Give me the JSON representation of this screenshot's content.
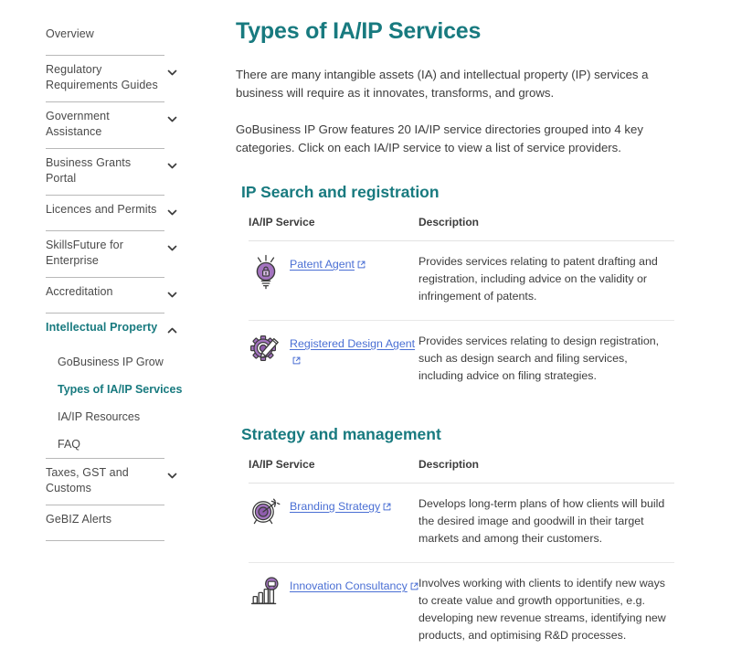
{
  "sidebar": {
    "items": [
      {
        "label": "Overview",
        "expandable": false,
        "active": false
      },
      {
        "label": "Regulatory Requirements Guides",
        "expandable": true,
        "active": false,
        "chevron": "chevron-down-icon"
      },
      {
        "label": "Government Assistance",
        "expandable": true,
        "active": false,
        "chevron": "chevron-down-icon"
      },
      {
        "label": "Business Grants Portal",
        "expandable": true,
        "active": false,
        "chevron": "chevron-down-icon"
      },
      {
        "label": "Licences and Permits",
        "expandable": true,
        "active": false,
        "chevron": "chevron-down-icon"
      },
      {
        "label": "SkillsFuture for Enterprise",
        "expandable": true,
        "active": false,
        "chevron": "chevron-down-icon"
      },
      {
        "label": "Accreditation",
        "expandable": true,
        "active": false,
        "chevron": "chevron-down-icon"
      },
      {
        "label": "Intellectual Property",
        "expandable": true,
        "active": true,
        "chevron": "chevron-up-icon"
      }
    ],
    "subitems": [
      {
        "label": "GoBusiness IP Grow",
        "active": false
      },
      {
        "label": "Types of IA/IP Services",
        "active": true
      },
      {
        "label": "IA/IP Resources",
        "active": false
      },
      {
        "label": "FAQ",
        "active": false
      }
    ],
    "items_after": [
      {
        "label": "Taxes, GST and Customs",
        "expandable": true,
        "active": false,
        "chevron": "chevron-down-icon"
      },
      {
        "label": "GeBIZ Alerts",
        "expandable": false,
        "active": false
      }
    ]
  },
  "main": {
    "title": "Types of IA/IP Services",
    "intro_1": "There are many intangible assets (IA) and intellectual property (IP) services a business will require as it innovates, transforms, and grows.",
    "intro_2": "GoBusiness IP Grow features 20 IA/IP service directories grouped into 4 key categories. Click on each IA/IP service to view a list of service providers.",
    "sections": [
      {
        "title": "IP Search and registration",
        "columns": {
          "service": "IA/IP Service",
          "description": "Description"
        },
        "rows": [
          {
            "icon": "lightbulb-padlock-icon",
            "link": "Patent Agent",
            "external_icon": "external-link-icon",
            "description": "Provides services relating to patent drafting and registration, including advice on the validity or infringement of patents."
          },
          {
            "icon": "gear-pencil-icon",
            "link": "Registered Design Agent",
            "external_icon": "external-link-icon",
            "description": "Provides services relating to design registration, such as design search and filing services, including advice on filing strategies."
          }
        ]
      },
      {
        "title": "Strategy and management",
        "columns": {
          "service": "IA/IP Service",
          "description": "Description"
        },
        "rows": [
          {
            "icon": "target-arrow-icon",
            "link": "Branding Strategy",
            "external_icon": "external-link-icon",
            "description": "Develops long-term plans of how clients will build the desired image and goodwill in their target markets and among their customers."
          },
          {
            "icon": "bar-chart-presentation-icon",
            "link": "Innovation Consultancy",
            "external_icon": "external-link-icon",
            "description": "Involves working with clients to identify new ways to create value and growth opportunities, e.g. developing new revenue streams, identifying new products, and optimising R&D processes."
          }
        ]
      }
    ]
  },
  "colors": {
    "heading_teal": "#187a7f",
    "link_blue": "#4a6fd4",
    "icon_purple": "#9b6fb5",
    "body_text": "#3c3c3c",
    "divider": "#b8b8b8"
  }
}
